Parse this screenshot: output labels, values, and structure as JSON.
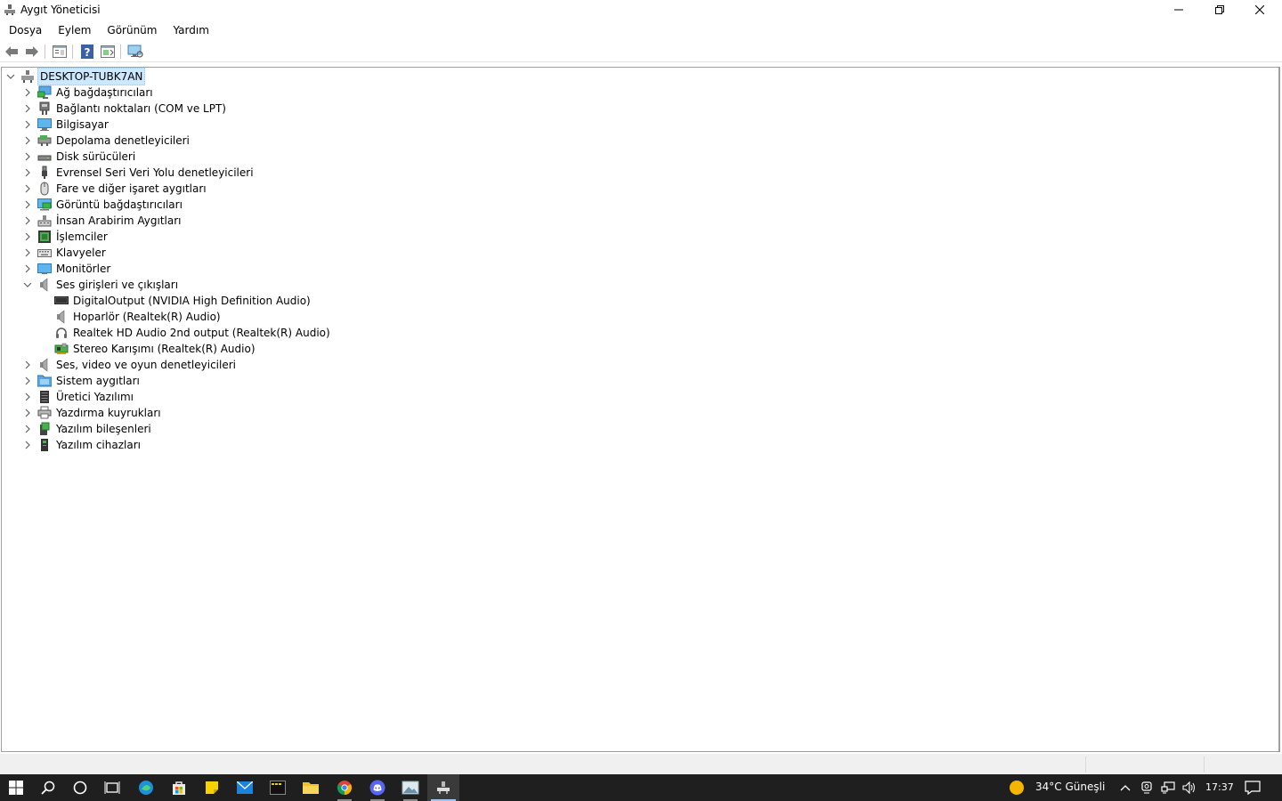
{
  "window": {
    "title": "Aygıt Yöneticisi"
  },
  "menu": [
    "Dosya",
    "Eylem",
    "Görünüm",
    "Yardım"
  ],
  "toolbar": {
    "buttons": [
      "back-arrow-icon",
      "forward-arrow-icon",
      "properties-icon",
      "help-icon",
      "update-driver-icon",
      "scan-hardware-icon"
    ]
  },
  "tree": {
    "root": "DESKTOP-TUBK7AN",
    "categories": [
      {
        "label": "Ağ bağdaştırıcıları",
        "icon": "network-adapter-icon",
        "expanded": false
      },
      {
        "label": "Bağlantı noktaları (COM ve LPT)",
        "icon": "port-icon",
        "expanded": false
      },
      {
        "label": "Bilgisayar",
        "icon": "computer-icon",
        "expanded": false
      },
      {
        "label": "Depolama denetleyicileri",
        "icon": "storage-controller-icon",
        "expanded": false
      },
      {
        "label": "Disk sürücüleri",
        "icon": "disk-drive-icon",
        "expanded": false
      },
      {
        "label": "Evrensel Seri Veri Yolu denetleyicileri",
        "icon": "usb-icon",
        "expanded": false
      },
      {
        "label": "Fare ve diğer işaret aygıtları",
        "icon": "mouse-icon",
        "expanded": false
      },
      {
        "label": "Görüntü bağdaştırıcıları",
        "icon": "display-adapter-icon",
        "expanded": false
      },
      {
        "label": "İnsan Arabirim Aygıtları",
        "icon": "hid-icon",
        "expanded": false
      },
      {
        "label": "İşlemciler",
        "icon": "processor-icon",
        "expanded": false
      },
      {
        "label": "Klavyeler",
        "icon": "keyboard-icon",
        "expanded": false
      },
      {
        "label": "Monitörler",
        "icon": "monitor-icon",
        "expanded": false
      },
      {
        "label": "Ses girişleri ve çıkışları",
        "icon": "speaker-icon",
        "expanded": true,
        "children": [
          {
            "label": "DigitalOutput (NVIDIA High Definition Audio)",
            "icon": "digital-output-icon"
          },
          {
            "label": "Hoparlör (Realtek(R) Audio)",
            "icon": "speaker-icon"
          },
          {
            "label": "Realtek HD Audio 2nd output (Realtek(R) Audio)",
            "icon": "headphones-icon"
          },
          {
            "label": "Stereo Karışımı (Realtek(R) Audio)",
            "icon": "sound-card-icon"
          }
        ]
      },
      {
        "label": "Ses, video ve oyun denetleyicileri",
        "icon": "speaker-icon",
        "expanded": false
      },
      {
        "label": "Sistem aygıtları",
        "icon": "system-devices-icon",
        "expanded": false
      },
      {
        "label": "Üretici Yazılımı",
        "icon": "firmware-icon",
        "expanded": false
      },
      {
        "label": "Yazdırma kuyrukları",
        "icon": "printer-icon",
        "expanded": false
      },
      {
        "label": "Yazılım bileşenleri",
        "icon": "software-component-icon",
        "expanded": false
      },
      {
        "label": "Yazılım cihazları",
        "icon": "software-device-icon",
        "expanded": false
      }
    ]
  },
  "taskbar": {
    "apps": [
      "start-icon",
      "search-icon",
      "cortana-icon",
      "task-view-icon",
      "edge-icon",
      "store-icon",
      "sticky-notes-icon",
      "mail-icon",
      "terminal-icon",
      "file-explorer-icon",
      "chrome-icon",
      "discord-icon",
      "photos-icon",
      "device-manager-icon"
    ],
    "weather": "34°C  Güneşli",
    "time": "17:37"
  },
  "colors": {
    "selection": "#cce8ff",
    "taskbar": "#1f1f1f",
    "chevron": "#606060"
  }
}
